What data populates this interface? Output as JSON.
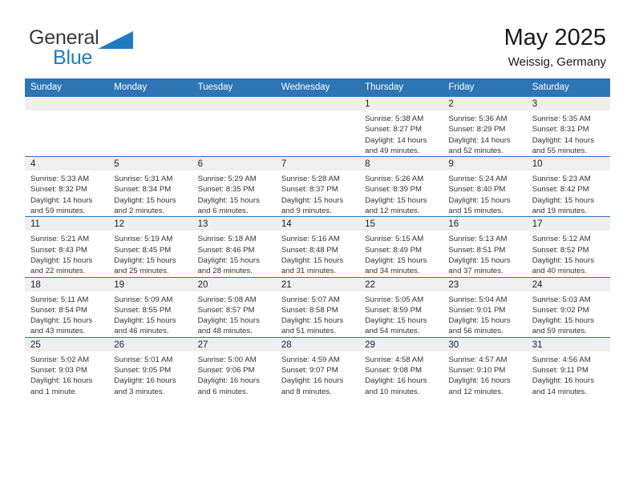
{
  "brand": {
    "name_top": "General",
    "name_bottom": "Blue",
    "accent_color": "#1f7bc1",
    "top_color": "#3a3a3a"
  },
  "header": {
    "title": "May 2025",
    "subtitle": "Weissig, Germany"
  },
  "theme": {
    "header_blue": "#2e75b6",
    "daynum_band": "#efefef",
    "row_divider": "#2e75b6"
  },
  "weekday_headers": [
    "Sunday",
    "Monday",
    "Tuesday",
    "Wednesday",
    "Thursday",
    "Friday",
    "Saturday"
  ],
  "weeks": [
    [
      {
        "day": "",
        "sunrise": "",
        "sunset": "",
        "daylight_1": "",
        "daylight_2": ""
      },
      {
        "day": "",
        "sunrise": "",
        "sunset": "",
        "daylight_1": "",
        "daylight_2": ""
      },
      {
        "day": "",
        "sunrise": "",
        "sunset": "",
        "daylight_1": "",
        "daylight_2": ""
      },
      {
        "day": "",
        "sunrise": "",
        "sunset": "",
        "daylight_1": "",
        "daylight_2": ""
      },
      {
        "day": "1",
        "sunrise": "Sunrise: 5:38 AM",
        "sunset": "Sunset: 8:27 PM",
        "daylight_1": "Daylight: 14 hours",
        "daylight_2": "and 49 minutes."
      },
      {
        "day": "2",
        "sunrise": "Sunrise: 5:36 AM",
        "sunset": "Sunset: 8:29 PM",
        "daylight_1": "Daylight: 14 hours",
        "daylight_2": "and 52 minutes."
      },
      {
        "day": "3",
        "sunrise": "Sunrise: 5:35 AM",
        "sunset": "Sunset: 8:31 PM",
        "daylight_1": "Daylight: 14 hours",
        "daylight_2": "and 55 minutes."
      }
    ],
    [
      {
        "day": "4",
        "sunrise": "Sunrise: 5:33 AM",
        "sunset": "Sunset: 8:32 PM",
        "daylight_1": "Daylight: 14 hours",
        "daylight_2": "and 59 minutes."
      },
      {
        "day": "5",
        "sunrise": "Sunrise: 5:31 AM",
        "sunset": "Sunset: 8:34 PM",
        "daylight_1": "Daylight: 15 hours",
        "daylight_2": "and 2 minutes."
      },
      {
        "day": "6",
        "sunrise": "Sunrise: 5:29 AM",
        "sunset": "Sunset: 8:35 PM",
        "daylight_1": "Daylight: 15 hours",
        "daylight_2": "and 6 minutes."
      },
      {
        "day": "7",
        "sunrise": "Sunrise: 5:28 AM",
        "sunset": "Sunset: 8:37 PM",
        "daylight_1": "Daylight: 15 hours",
        "daylight_2": "and 9 minutes."
      },
      {
        "day": "8",
        "sunrise": "Sunrise: 5:26 AM",
        "sunset": "Sunset: 8:39 PM",
        "daylight_1": "Daylight: 15 hours",
        "daylight_2": "and 12 minutes."
      },
      {
        "day": "9",
        "sunrise": "Sunrise: 5:24 AM",
        "sunset": "Sunset: 8:40 PM",
        "daylight_1": "Daylight: 15 hours",
        "daylight_2": "and 15 minutes."
      },
      {
        "day": "10",
        "sunrise": "Sunrise: 5:23 AM",
        "sunset": "Sunset: 8:42 PM",
        "daylight_1": "Daylight: 15 hours",
        "daylight_2": "and 19 minutes."
      }
    ],
    [
      {
        "day": "11",
        "sunrise": "Sunrise: 5:21 AM",
        "sunset": "Sunset: 8:43 PM",
        "daylight_1": "Daylight: 15 hours",
        "daylight_2": "and 22 minutes."
      },
      {
        "day": "12",
        "sunrise": "Sunrise: 5:19 AM",
        "sunset": "Sunset: 8:45 PM",
        "daylight_1": "Daylight: 15 hours",
        "daylight_2": "and 25 minutes."
      },
      {
        "day": "13",
        "sunrise": "Sunrise: 5:18 AM",
        "sunset": "Sunset: 8:46 PM",
        "daylight_1": "Daylight: 15 hours",
        "daylight_2": "and 28 minutes."
      },
      {
        "day": "14",
        "sunrise": "Sunrise: 5:16 AM",
        "sunset": "Sunset: 8:48 PM",
        "daylight_1": "Daylight: 15 hours",
        "daylight_2": "and 31 minutes."
      },
      {
        "day": "15",
        "sunrise": "Sunrise: 5:15 AM",
        "sunset": "Sunset: 8:49 PM",
        "daylight_1": "Daylight: 15 hours",
        "daylight_2": "and 34 minutes."
      },
      {
        "day": "16",
        "sunrise": "Sunrise: 5:13 AM",
        "sunset": "Sunset: 8:51 PM",
        "daylight_1": "Daylight: 15 hours",
        "daylight_2": "and 37 minutes."
      },
      {
        "day": "17",
        "sunrise": "Sunrise: 5:12 AM",
        "sunset": "Sunset: 8:52 PM",
        "daylight_1": "Daylight: 15 hours",
        "daylight_2": "and 40 minutes."
      }
    ],
    [
      {
        "day": "18",
        "sunrise": "Sunrise: 5:11 AM",
        "sunset": "Sunset: 8:54 PM",
        "daylight_1": "Daylight: 15 hours",
        "daylight_2": "and 43 minutes."
      },
      {
        "day": "19",
        "sunrise": "Sunrise: 5:09 AM",
        "sunset": "Sunset: 8:55 PM",
        "daylight_1": "Daylight: 15 hours",
        "daylight_2": "and 46 minutes."
      },
      {
        "day": "20",
        "sunrise": "Sunrise: 5:08 AM",
        "sunset": "Sunset: 8:57 PM",
        "daylight_1": "Daylight: 15 hours",
        "daylight_2": "and 48 minutes."
      },
      {
        "day": "21",
        "sunrise": "Sunrise: 5:07 AM",
        "sunset": "Sunset: 8:58 PM",
        "daylight_1": "Daylight: 15 hours",
        "daylight_2": "and 51 minutes."
      },
      {
        "day": "22",
        "sunrise": "Sunrise: 5:05 AM",
        "sunset": "Sunset: 8:59 PM",
        "daylight_1": "Daylight: 15 hours",
        "daylight_2": "and 54 minutes."
      },
      {
        "day": "23",
        "sunrise": "Sunrise: 5:04 AM",
        "sunset": "Sunset: 9:01 PM",
        "daylight_1": "Daylight: 15 hours",
        "daylight_2": "and 56 minutes."
      },
      {
        "day": "24",
        "sunrise": "Sunrise: 5:03 AM",
        "sunset": "Sunset: 9:02 PM",
        "daylight_1": "Daylight: 15 hours",
        "daylight_2": "and 59 minutes."
      }
    ],
    [
      {
        "day": "25",
        "sunrise": "Sunrise: 5:02 AM",
        "sunset": "Sunset: 9:03 PM",
        "daylight_1": "Daylight: 16 hours",
        "daylight_2": "and 1 minute."
      },
      {
        "day": "26",
        "sunrise": "Sunrise: 5:01 AM",
        "sunset": "Sunset: 9:05 PM",
        "daylight_1": "Daylight: 16 hours",
        "daylight_2": "and 3 minutes."
      },
      {
        "day": "27",
        "sunrise": "Sunrise: 5:00 AM",
        "sunset": "Sunset: 9:06 PM",
        "daylight_1": "Daylight: 16 hours",
        "daylight_2": "and 6 minutes."
      },
      {
        "day": "28",
        "sunrise": "Sunrise: 4:59 AM",
        "sunset": "Sunset: 9:07 PM",
        "daylight_1": "Daylight: 16 hours",
        "daylight_2": "and 8 minutes."
      },
      {
        "day": "29",
        "sunrise": "Sunrise: 4:58 AM",
        "sunset": "Sunset: 9:08 PM",
        "daylight_1": "Daylight: 16 hours",
        "daylight_2": "and 10 minutes."
      },
      {
        "day": "30",
        "sunrise": "Sunrise: 4:57 AM",
        "sunset": "Sunset: 9:10 PM",
        "daylight_1": "Daylight: 16 hours",
        "daylight_2": "and 12 minutes."
      },
      {
        "day": "31",
        "sunrise": "Sunrise: 4:56 AM",
        "sunset": "Sunset: 9:11 PM",
        "daylight_1": "Daylight: 16 hours",
        "daylight_2": "and 14 minutes."
      }
    ]
  ]
}
